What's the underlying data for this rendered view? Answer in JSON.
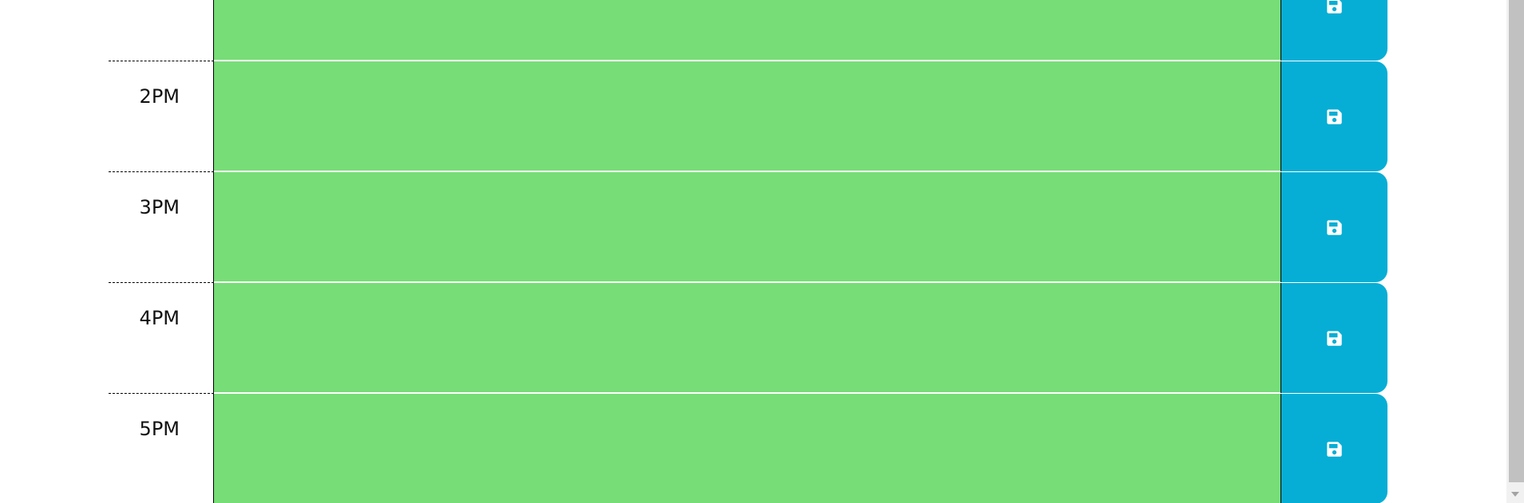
{
  "schedule": {
    "rows": [
      {
        "hour": "",
        "text": ""
      },
      {
        "hour": "2PM",
        "text": ""
      },
      {
        "hour": "3PM",
        "text": ""
      },
      {
        "hour": "4PM",
        "text": ""
      },
      {
        "hour": "5PM",
        "text": ""
      }
    ],
    "save_icon": "floppy-disk-icon"
  },
  "colors": {
    "present_row": "#77dd77",
    "save_button": "#06aed5",
    "save_icon": "#ffffff"
  }
}
